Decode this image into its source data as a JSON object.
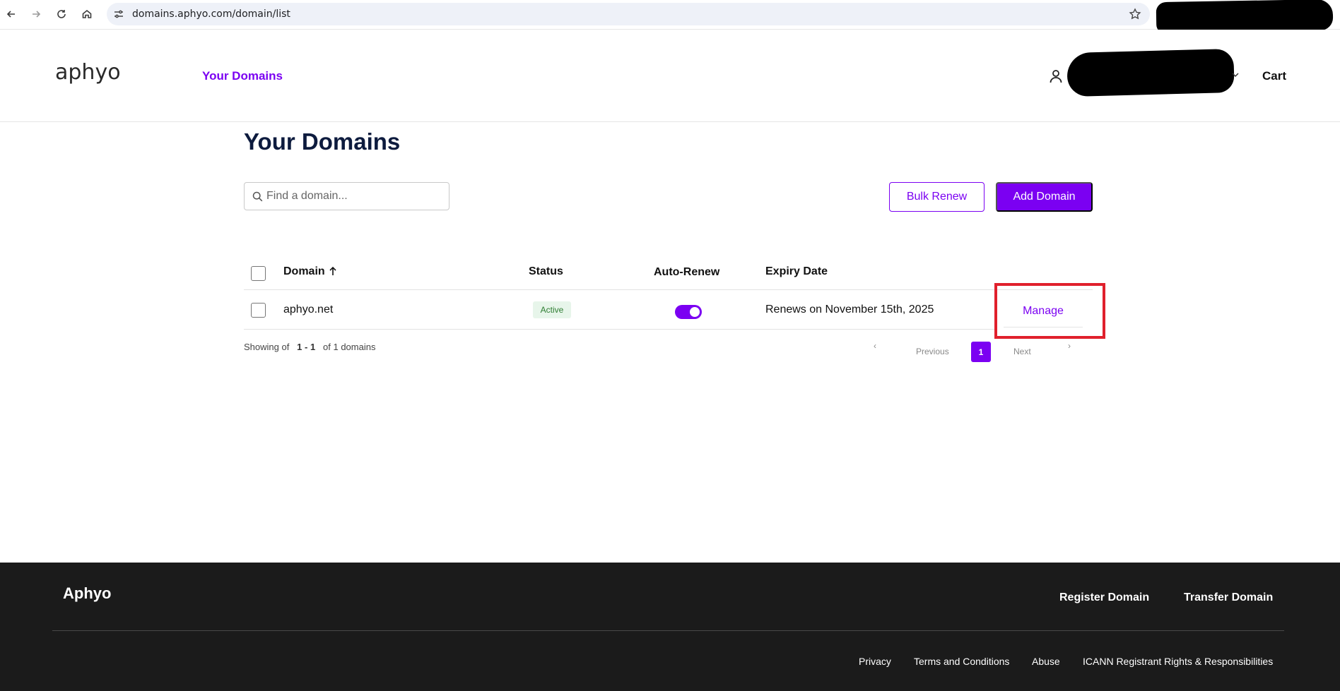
{
  "browser": {
    "url": "domains.aphyo.com/domain/list"
  },
  "header": {
    "logo_text": "aphyo",
    "nav_your_domains": "Your Domains",
    "cart": "Cart"
  },
  "main": {
    "title": "Your Domains",
    "search_placeholder": "Find a domain...",
    "bulk_renew": "Bulk Renew",
    "add_domain": "Add Domain"
  },
  "table": {
    "columns": {
      "domain": "Domain",
      "status": "Status",
      "auto_renew": "Auto-Renew",
      "expiry": "Expiry Date"
    },
    "sort": {
      "column": "Domain",
      "direction": "ascending"
    },
    "rows": [
      {
        "domain": "aphyo.net",
        "status": "Active",
        "auto_renew": true,
        "expiry": "Renews on November 15th, 2025",
        "action": "Manage"
      }
    ]
  },
  "pagination": {
    "showing_prefix": "Showing of",
    "range": "1 - 1",
    "total": "of 1 domains",
    "prev_arrow": "‹",
    "previous": "Previous",
    "current_page": "1",
    "next": "Next",
    "next_arrow": "›"
  },
  "footer": {
    "brand": "Aphyo",
    "register_domain": "Register Domain",
    "transfer_domain": "Transfer Domain",
    "privacy": "Privacy",
    "terms": "Terms and Conditions",
    "abuse": "Abuse",
    "icann": "ICANN Registrant Rights & Responsibilities"
  },
  "colors": {
    "accent": "#7b00f2",
    "title": "#0d1b3e",
    "footer_bg": "#1b1b1b",
    "highlight": "#e0202c",
    "status_active_bg": "#e7f5ea",
    "status_active_text": "#2e7d32"
  }
}
